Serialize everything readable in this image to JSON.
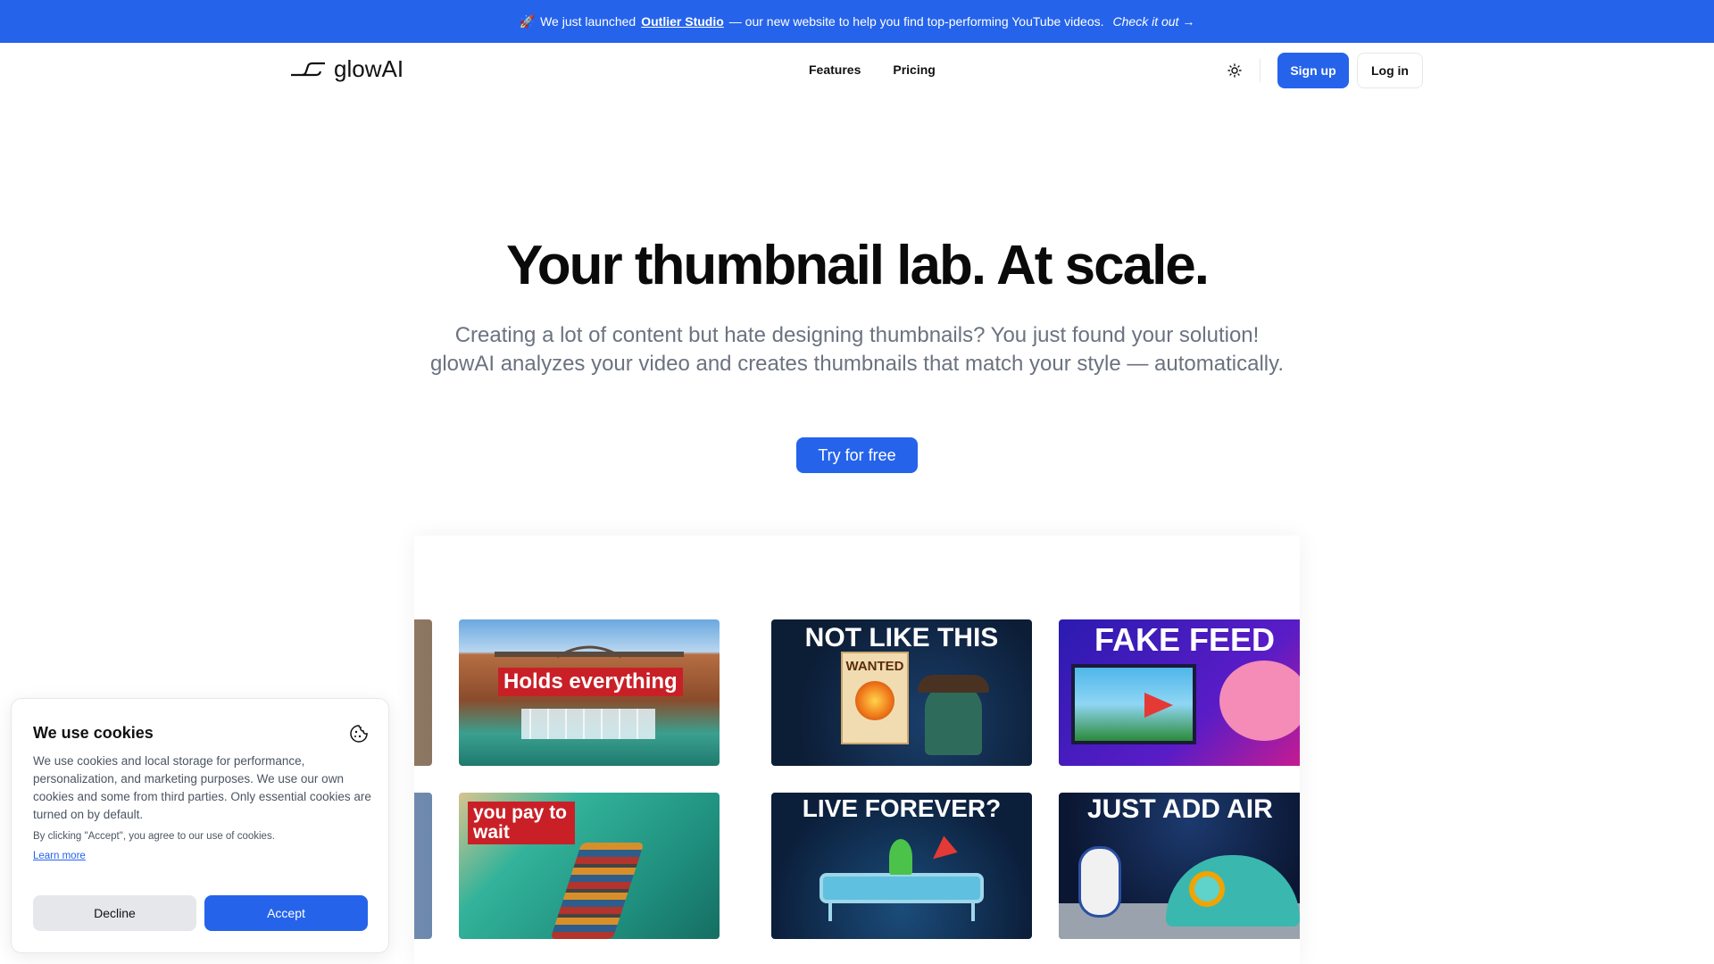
{
  "banner": {
    "emoji": "🚀",
    "text_before": "We just launched",
    "link_label": "Outlier Studio",
    "text_after": "— our new website to help you find top-performing YouTube videos.",
    "cta": "Check it out →"
  },
  "nav": {
    "logo_text": "glowAI",
    "links": [
      "Features",
      "Pricing"
    ],
    "theme_icon": "sun-icon",
    "signup": "Sign up",
    "login": "Log in"
  },
  "hero": {
    "title": "Your thumbnail lab. At scale.",
    "subtitle": "Creating a lot of content but hate designing thumbnails? You just found your solution! glowAI analyzes your video and creates thumbnails that match your style — automatically.",
    "cta": "Try for free"
  },
  "gallery": {
    "thumbnails": [
      {
        "caption": "Holds everything"
      },
      {
        "caption": "NOT LIKE THIS",
        "sub": "WANTED"
      },
      {
        "caption": "FAKE FEED"
      },
      {
        "caption": "you pay to wait"
      },
      {
        "caption": "LIVE FOREVER?"
      },
      {
        "caption": "JUST ADD AIR"
      }
    ]
  },
  "cookie": {
    "title": "We use cookies",
    "body": "We use cookies and local storage for performance, personalization, and marketing purposes. We use our own cookies and some from third parties. Only essential cookies are turned on by default.",
    "fine_print": "By clicking \"Accept\", you agree to our use of cookies.",
    "learn_more": "Learn more",
    "decline": "Decline",
    "accept": "Accept"
  },
  "colors": {
    "accent": "#2563eb",
    "text": "#111827",
    "muted": "#6b7280"
  }
}
